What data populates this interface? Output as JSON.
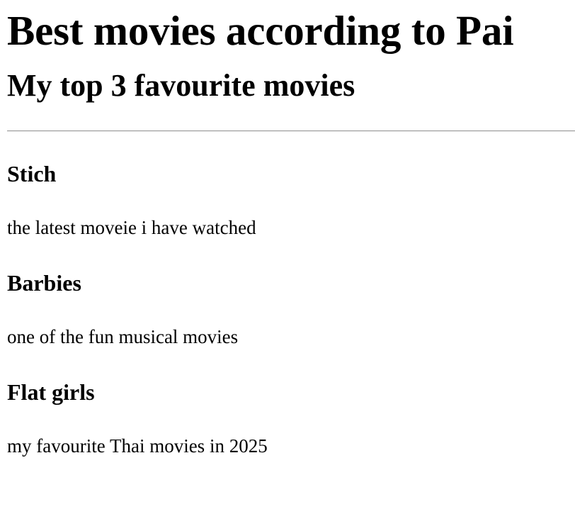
{
  "page": {
    "title": "Best movies according to Pai",
    "subtitle": "My top 3 favourite movies"
  },
  "movies": [
    {
      "title": "Stich",
      "description": "the latest moveie i have watched"
    },
    {
      "title": "Barbies",
      "description": "one of the fun musical movies"
    },
    {
      "title": "Flat girls",
      "description": "my favourite Thai movies in 2025"
    }
  ]
}
